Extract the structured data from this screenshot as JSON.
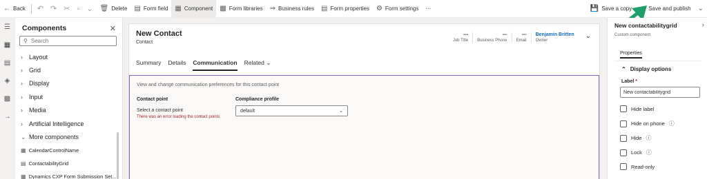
{
  "toolbar": {
    "back": "Back",
    "delete": "Delete",
    "form_field": "Form field",
    "component": "Component",
    "form_libraries": "Form libraries",
    "business_rules": "Business rules",
    "form_properties": "Form properties",
    "form_settings": "Form settings",
    "more": "···",
    "save_copy": "Save a copy",
    "save_publish": "Save and publish"
  },
  "components": {
    "title": "Components",
    "search_placeholder": "Search",
    "categories": [
      "Layout",
      "Grid",
      "Display",
      "Input",
      "Media",
      "Artificial Intelligence"
    ],
    "more_label": "More components",
    "more_items": [
      "CalendarControlName",
      "ContactabilityGrid",
      "Dynamics CXP Form Submission Set..."
    ]
  },
  "form": {
    "title": "New Contact",
    "subtitle": "Contact",
    "header_fields": [
      {
        "value": "---",
        "label": "Job Title"
      },
      {
        "value": "---",
        "label": "Business Phone"
      },
      {
        "value": "---",
        "label": "Email"
      }
    ],
    "owner": {
      "value": "Benjamin Britten",
      "label": "Owner"
    },
    "tabs": [
      "Summary",
      "Details",
      "Communication",
      "Related"
    ],
    "active_tab": "Communication",
    "section": {
      "description": "View and change communication preferences for this contact point",
      "contact_point_label": "Contact point",
      "contact_point_value": "Select a contact point",
      "error": "There was an error loading the contact points",
      "compliance_label": "Compliance profile",
      "compliance_value": "default"
    }
  },
  "properties": {
    "title": "New contactabilitygrid",
    "subtitle": "Custom component",
    "tab": "Properties",
    "section": "Display options",
    "label_field": "Label",
    "label_value": "New contactabilitygrid",
    "options": [
      "Hide label",
      "Hide on phone",
      "Hide",
      "Lock",
      "Read-only"
    ]
  },
  "colors": {
    "accent_purple": "#8764b8",
    "link_blue": "#0f6cbd",
    "error_red": "#a4262c",
    "callout_green": "#1f9e6d"
  }
}
